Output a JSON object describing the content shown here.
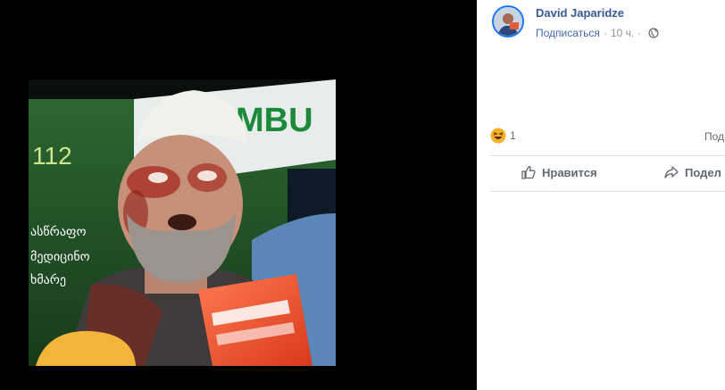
{
  "post": {
    "author": "David Japaridze",
    "follow_label": "Подписаться",
    "separator": "·",
    "time": "10 ч.",
    "time_separator": "·"
  },
  "photo": {
    "sign_text": "MBU",
    "sign_number": "112",
    "georgian_lines": [
      "ასწრაფო",
      "მედიცინო",
      "ხმარე"
    ]
  },
  "reactions": {
    "count": "1",
    "shares_label": "Под"
  },
  "actions": {
    "like_label": "Нравится",
    "share_label": "Подел"
  },
  "colors": {
    "link_blue": "#385898",
    "follow_blue": "#4267b2",
    "muted_gray": "#606770",
    "viewer_bg": "#000000"
  },
  "icons": [
    "globe-icon",
    "haha-reaction-icon",
    "thumbs-up-icon",
    "share-arrow-icon"
  ]
}
